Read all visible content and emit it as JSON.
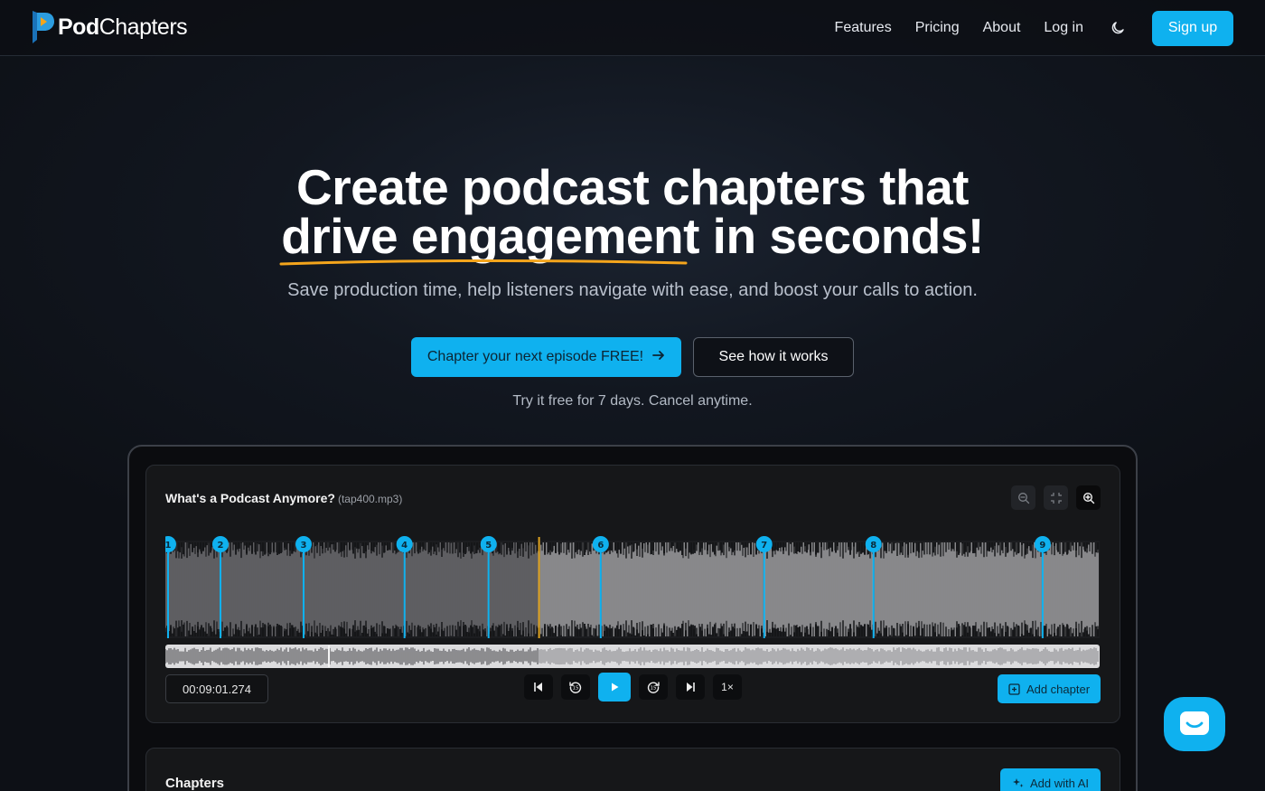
{
  "nav": {
    "logo": {
      "bold": "Pod",
      "regular": "Chapters"
    },
    "links": [
      "Features",
      "Pricing",
      "About",
      "Log in"
    ],
    "theme_icon": "moon-icon",
    "signup_label": "Sign up"
  },
  "hero": {
    "title_line1": "Create podcast chapters that",
    "title_highlight": "drive engagement",
    "title_rest": " in seconds!",
    "subtitle": "Save production time, help listeners navigate with ease, and boost your calls to action.",
    "cta_primary": "Chapter your next episode FREE!",
    "cta_secondary": "See how it works",
    "trial_note": "Try it free for 7 days. Cancel anytime."
  },
  "player": {
    "episode_title": "What's a Podcast Anymore?",
    "file_name": "(tap400.mp3)",
    "current_time": "00:09:01.274",
    "playback_speed": "1×",
    "add_chapter_label": "Add chapter",
    "playhead_fraction": 0.4,
    "chapter_markers": [
      {
        "label": "1",
        "position_fraction": 0.0
      },
      {
        "label": "2",
        "position_fraction": 0.058
      },
      {
        "label": "3",
        "position_fraction": 0.147
      },
      {
        "label": "4",
        "position_fraction": 0.255
      },
      {
        "label": "5",
        "position_fraction": 0.345
      },
      {
        "label": "6",
        "position_fraction": 0.465
      },
      {
        "label": "7",
        "position_fraction": 0.64
      },
      {
        "label": "8",
        "position_fraction": 0.757
      },
      {
        "label": "9",
        "position_fraction": 0.938
      }
    ],
    "icons": {
      "zoom": [
        "zoom-out-icon",
        "fit-icon",
        "zoom-in-icon"
      ],
      "transport": [
        "skip-back-icon",
        "rewind-icon",
        "play-icon",
        "forward-icon",
        "skip-forward-icon"
      ]
    }
  },
  "chapters": {
    "title": "Chapters",
    "add_ai_label": "Add with AI"
  },
  "colors": {
    "accent": "#0fb1ef",
    "playhead": "#e0a420",
    "underline": "#f4a51c"
  }
}
